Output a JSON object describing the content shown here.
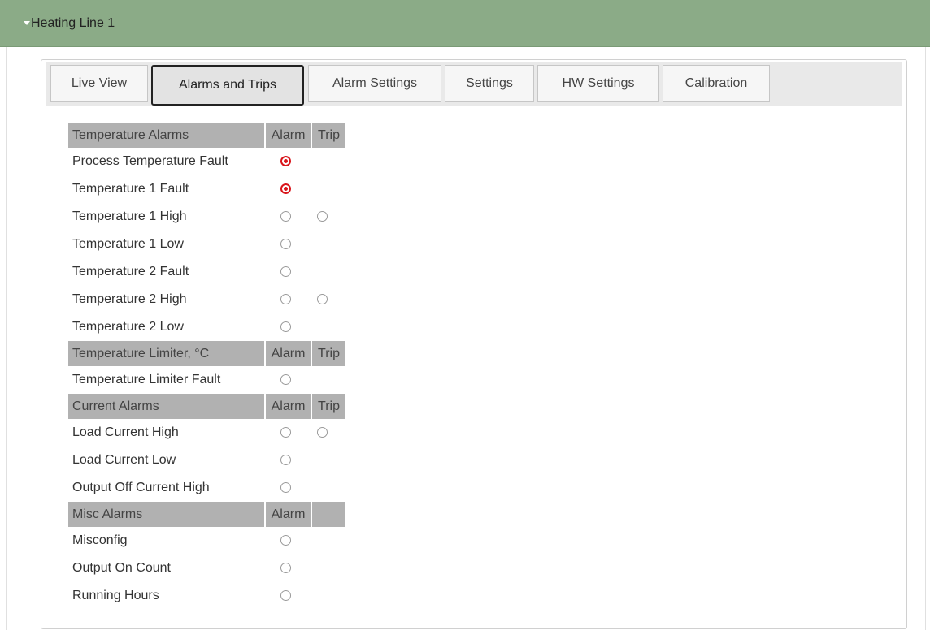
{
  "panel": {
    "title": "Heating Line 1"
  },
  "tabs": [
    {
      "label": "Live View",
      "active": false
    },
    {
      "label": "Alarms and Trips",
      "active": true
    },
    {
      "label": "Alarm Settings",
      "active": false
    },
    {
      "label": "Settings",
      "active": false
    },
    {
      "label": "HW Settings",
      "active": false
    },
    {
      "label": "Calibration",
      "active": false
    }
  ],
  "colors": {
    "header_bg": "#8bab87",
    "group_header_bg": "#b1b1b1",
    "active_indicator": "#d9161c"
  },
  "groups": [
    {
      "title": "Temperature Alarms",
      "alarm_col": "Alarm",
      "trip_col": "Trip",
      "rows": [
        {
          "label": "Process Temperature Fault",
          "alarm": "on",
          "trip": null
        },
        {
          "label": "Temperature 1 Fault",
          "alarm": "on",
          "trip": null
        },
        {
          "label": "Temperature 1 High",
          "alarm": "off",
          "trip": "off"
        },
        {
          "label": "Temperature 1 Low",
          "alarm": "off",
          "trip": null
        },
        {
          "label": "Temperature 2 Fault",
          "alarm": "off",
          "trip": null
        },
        {
          "label": "Temperature 2 High",
          "alarm": "off",
          "trip": "off"
        },
        {
          "label": "Temperature 2 Low",
          "alarm": "off",
          "trip": null
        }
      ]
    },
    {
      "title": "Temperature Limiter, °C",
      "alarm_col": "Alarm",
      "trip_col": "Trip",
      "rows": [
        {
          "label": "Temperature Limiter Fault",
          "alarm": "off",
          "trip": null
        }
      ]
    },
    {
      "title": "Current Alarms",
      "alarm_col": "Alarm",
      "trip_col": "Trip",
      "rows": [
        {
          "label": "Load Current High",
          "alarm": "off",
          "trip": "off"
        },
        {
          "label": "Load Current Low",
          "alarm": "off",
          "trip": null
        },
        {
          "label": "Output Off Current High",
          "alarm": "off",
          "trip": null
        }
      ]
    },
    {
      "title": "Misc Alarms",
      "alarm_col": "Alarm",
      "trip_col": "",
      "rows": [
        {
          "label": "Misconfig",
          "alarm": "off",
          "trip": null
        },
        {
          "label": "Output On Count",
          "alarm": "off",
          "trip": null
        },
        {
          "label": "Running Hours",
          "alarm": "off",
          "trip": null
        }
      ]
    }
  ]
}
